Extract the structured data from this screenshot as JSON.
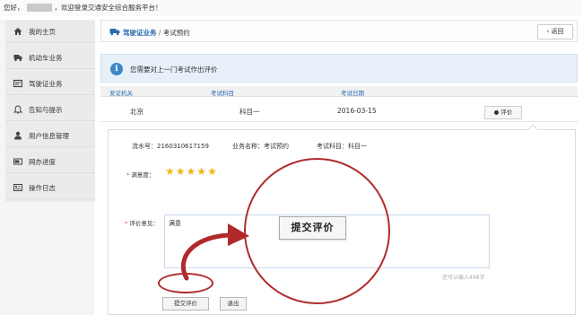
{
  "header": {
    "greeting_prefix": "您好，",
    "greeting_suffix": "，欢迎登录交通安全综合服务平台！"
  },
  "sidebar": {
    "items": [
      {
        "label": "我的主页",
        "icon": "home-icon"
      },
      {
        "label": "机动车业务",
        "icon": "truck-icon"
      },
      {
        "label": "驾驶证业务",
        "icon": "license-card-icon"
      },
      {
        "label": "告知与提示",
        "icon": "bell-icon"
      },
      {
        "label": "用户信息管理",
        "icon": "user-icon"
      },
      {
        "label": "网办进度",
        "icon": "progress-icon"
      },
      {
        "label": "操作日志",
        "icon": "log-icon"
      }
    ]
  },
  "breadcrumb": {
    "section": "驾驶证业务",
    "separator": " / ",
    "page": "考试预约",
    "back_label": "返回"
  },
  "notice": {
    "text": "您需要对上一门考试作出评价"
  },
  "table": {
    "headers": [
      "发证机关",
      "考试科目",
      "考试日期"
    ],
    "rows": [
      {
        "authority": "北京",
        "subject": "科目一",
        "date": "2016-03-15",
        "action": "评价"
      }
    ]
  },
  "evaluation": {
    "serial_label": "流水号：",
    "serial_value": "2160310617159",
    "business_label": "业务名称：",
    "business_value": "考试预约",
    "subject_label": "考试科目：",
    "subject_value": "科目一",
    "satisfaction_label": "满意度：",
    "satisfaction_stars": 5,
    "satisfaction_max": 5,
    "opinion_label": "评价意见：",
    "opinion_value": "满意",
    "counter_text": "还可以输入498字",
    "submit_label": "提交评价",
    "exit_label": "退出"
  },
  "callout": {
    "zoom_label": "提交评价"
  },
  "colors": {
    "accent": "#2a6bb0",
    "highlight": "#b02a2a",
    "star": "#f1b71a"
  }
}
